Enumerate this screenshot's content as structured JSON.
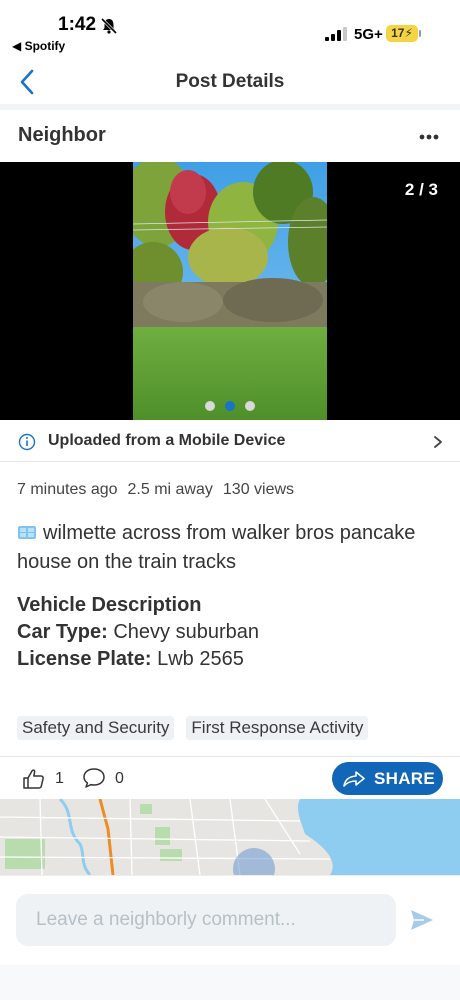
{
  "status_bar": {
    "time": "1:42",
    "back_app": "◀ Spotify",
    "network": "5G+",
    "battery": "17"
  },
  "nav": {
    "title": "Post Details"
  },
  "post": {
    "author": "Neighbor",
    "photo_counter": "2 / 3",
    "photo_dots_active_index": 1,
    "uploaded_text": "Uploaded from a Mobile Device",
    "meta": {
      "time_ago": "7 minutes ago",
      "distance": "2.5 mi away",
      "views": "130 views"
    },
    "body": "wilmette across from walker bros pancake house on the train tracks",
    "vehicle": {
      "heading": "Vehicle Description",
      "car_type_label": "Car Type:",
      "car_type_value": "Chevy suburban",
      "plate_label": "License Plate:",
      "plate_value": "Lwb 2565"
    },
    "tags": [
      "Safety and Security",
      "First Response Activity"
    ],
    "likes": "1",
    "comments": "0",
    "share_label": "SHARE"
  },
  "comment_box": {
    "placeholder": "Leave a neighborly comment..."
  },
  "colors": {
    "accent": "#1266b8",
    "link_blue": "#1a73c9",
    "tag_bg": "#eef2f5"
  }
}
